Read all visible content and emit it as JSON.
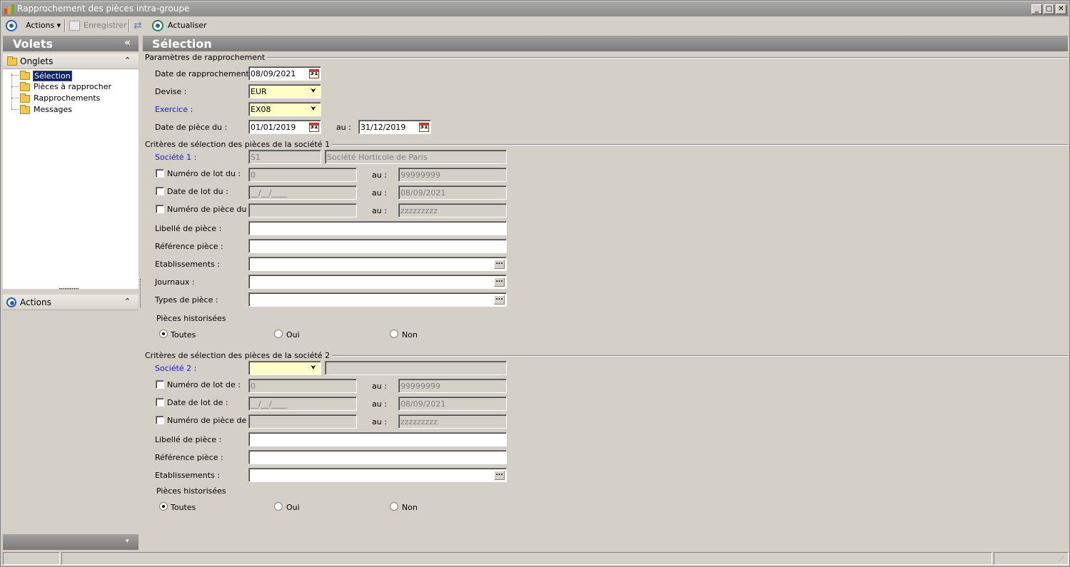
{
  "window": {
    "title": "Rapprochement des pièces intra-groupe",
    "min": "_",
    "max": "□",
    "close": "✕"
  },
  "toolbar": {
    "actions": "Actions",
    "enregistrer": "Enregistrer",
    "actualiser": "Actualiser"
  },
  "left": {
    "volets": "Volets",
    "collapse": "«",
    "onglets": "Onglets",
    "tree": [
      "Sélection",
      "Pièces à rapprocher",
      "Rapprochements",
      "Messages"
    ],
    "actions": "Actions",
    "grip": "•••••••••••"
  },
  "main": {
    "title": "Sélection",
    "params": {
      "section": "Paramètres de rapprochement",
      "date_rappro_label": "Date de rapprochement :",
      "date_rappro_value": "08/09/2021",
      "devise_label": "Devise :",
      "devise_value": "EUR",
      "exercice_label": "Exercice :",
      "exercice_value": "EX08",
      "date_piece_label": "Date de pièce du :",
      "date_piece_from": "01/01/2019",
      "au": "au :",
      "date_piece_to": "31/12/2019"
    },
    "soc1": {
      "section": "Critères de sélection des pièces de la société 1",
      "societe_label": "Société 1 :",
      "societe_code": "S1",
      "societe_name": "Société Horticole de Paris",
      "lot_label": "Numéro de lot du :",
      "lot_from": "0",
      "lot_to": "99999999",
      "datelot_label": "Date de lot du :",
      "datelot_from": "__/__/____",
      "datelot_to": "08/09/2021",
      "piece_label": "Numéro de pièce du :",
      "piece_from": "",
      "piece_to": "zzzzzzzzz",
      "au": "au :",
      "libelle_label": "Libellé de pièce :",
      "reference_label": "Référence pièce :",
      "etab_label": "Etablissements :",
      "journaux_label": "Journaux :",
      "types_label": "Types de pièce :",
      "hist_label": "Pièces historisées",
      "opt_toutes": "Toutes",
      "opt_oui": "Oui",
      "opt_non": "Non"
    },
    "soc2": {
      "section": "Critères de sélection des pièces de la société 2",
      "societe_label": "Société 2 :",
      "lot_label": "Numéro de lot de :",
      "lot_from": "0",
      "lot_to": "99999999",
      "datelot_label": "Date de lot de :",
      "datelot_from": "__/__/____",
      "datelot_to": "08/09/2021",
      "piece_label": "Numéro de pièce de :",
      "piece_to": "zzzzzzzzz",
      "au": "au :",
      "libelle_label": "Libellé de pièce :",
      "reference_label": "Référence pièce :",
      "etab_label": "Etablissements :",
      "hist_label": "Pièces historisées",
      "opt_toutes": "Toutes",
      "opt_oui": "Oui",
      "opt_non": "Non"
    },
    "cal": "31",
    "dd": "⮟",
    "ell": "..."
  }
}
